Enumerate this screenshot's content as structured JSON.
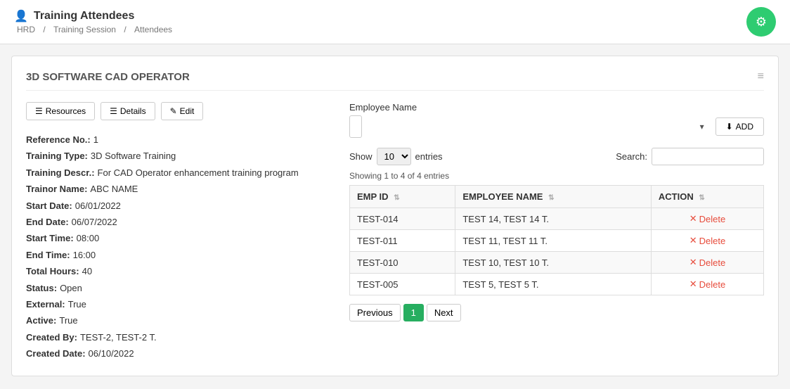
{
  "header": {
    "icon": "👤",
    "title": "Training Attendees",
    "breadcrumb": [
      "HRD",
      "Training Session",
      "Attendees"
    ]
  },
  "gear_icon": "⚙",
  "section": {
    "title": "3D SOFTWARE CAD OPERATOR",
    "menu_icon": "≡"
  },
  "toolbar": {
    "resources_label": "Resources",
    "details_label": "Details",
    "edit_label": "Edit"
  },
  "info": {
    "reference_no_label": "Reference No.:",
    "reference_no_value": "1",
    "training_type_label": "Training Type:",
    "training_type_value": "3D Software Training",
    "training_descr_label": "Training Descr.:",
    "training_descr_value": "For CAD Operator enhancement training program",
    "trainor_name_label": "Trainor Name:",
    "trainor_name_value": "ABC NAME",
    "start_date_label": "Start Date:",
    "start_date_value": "06/01/2022",
    "end_date_label": "End Date:",
    "end_date_value": "06/07/2022",
    "start_time_label": "Start Time:",
    "start_time_value": "08:00",
    "end_time_label": "End Time:",
    "end_time_value": "16:00",
    "total_hours_label": "Total Hours:",
    "total_hours_value": "40",
    "status_label": "Status:",
    "status_value": "Open",
    "external_label": "External:",
    "external_value": "True",
    "active_label": "Active:",
    "active_value": "True",
    "created_by_label": "Created By:",
    "created_by_value": "TEST-2, TEST-2 T.",
    "created_date_label": "Created Date:",
    "created_date_value": "06/10/2022"
  },
  "right_panel": {
    "employee_name_label": "Employee Name",
    "add_button": "ADD",
    "show_label": "Show",
    "entries_label": "entries",
    "search_label": "Search:",
    "showing_text": "Showing 1 to 4 of 4 entries",
    "columns": [
      {
        "label": "EMP ID",
        "sort": true
      },
      {
        "label": "EMPLOYEE NAME",
        "sort": true
      },
      {
        "label": "ACTION",
        "sort": true
      }
    ],
    "rows": [
      {
        "emp_id": "TEST-014",
        "employee_name": "TEST 14, TEST 14 T.",
        "action": "Delete"
      },
      {
        "emp_id": "TEST-011",
        "employee_name": "TEST 11, TEST 11 T.",
        "action": "Delete"
      },
      {
        "emp_id": "TEST-010",
        "employee_name": "TEST 10, TEST 10 T.",
        "action": "Delete"
      },
      {
        "emp_id": "TEST-005",
        "employee_name": "TEST 5, TEST 5 T.",
        "action": "Delete"
      }
    ],
    "pagination": {
      "previous": "Previous",
      "current_page": "1",
      "next": "Next"
    }
  }
}
